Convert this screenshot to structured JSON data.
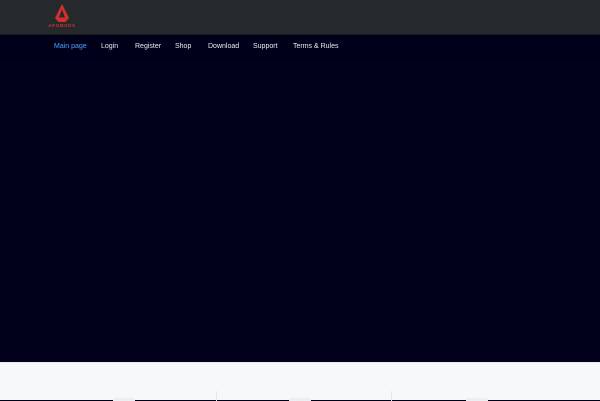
{
  "logo": {
    "text": "AFGMODS",
    "icon": "logo-icon",
    "brand_color": "#d32f2f"
  },
  "nav": {
    "items": [
      {
        "label": "Main page",
        "active": true
      },
      {
        "label": "Login",
        "active": false
      },
      {
        "label": "Register",
        "active": false
      },
      {
        "label": "Shop",
        "active": false
      },
      {
        "label": "Download",
        "active": false
      },
      {
        "label": "Support",
        "active": false
      },
      {
        "label": "Terms & Rules",
        "active": false
      }
    ],
    "active_color": "#4aa3ff",
    "text_color": "#e9ecf2"
  },
  "colors": {
    "topbar": "#26292c",
    "background": "#00001a",
    "content": "#f7f8fa"
  }
}
